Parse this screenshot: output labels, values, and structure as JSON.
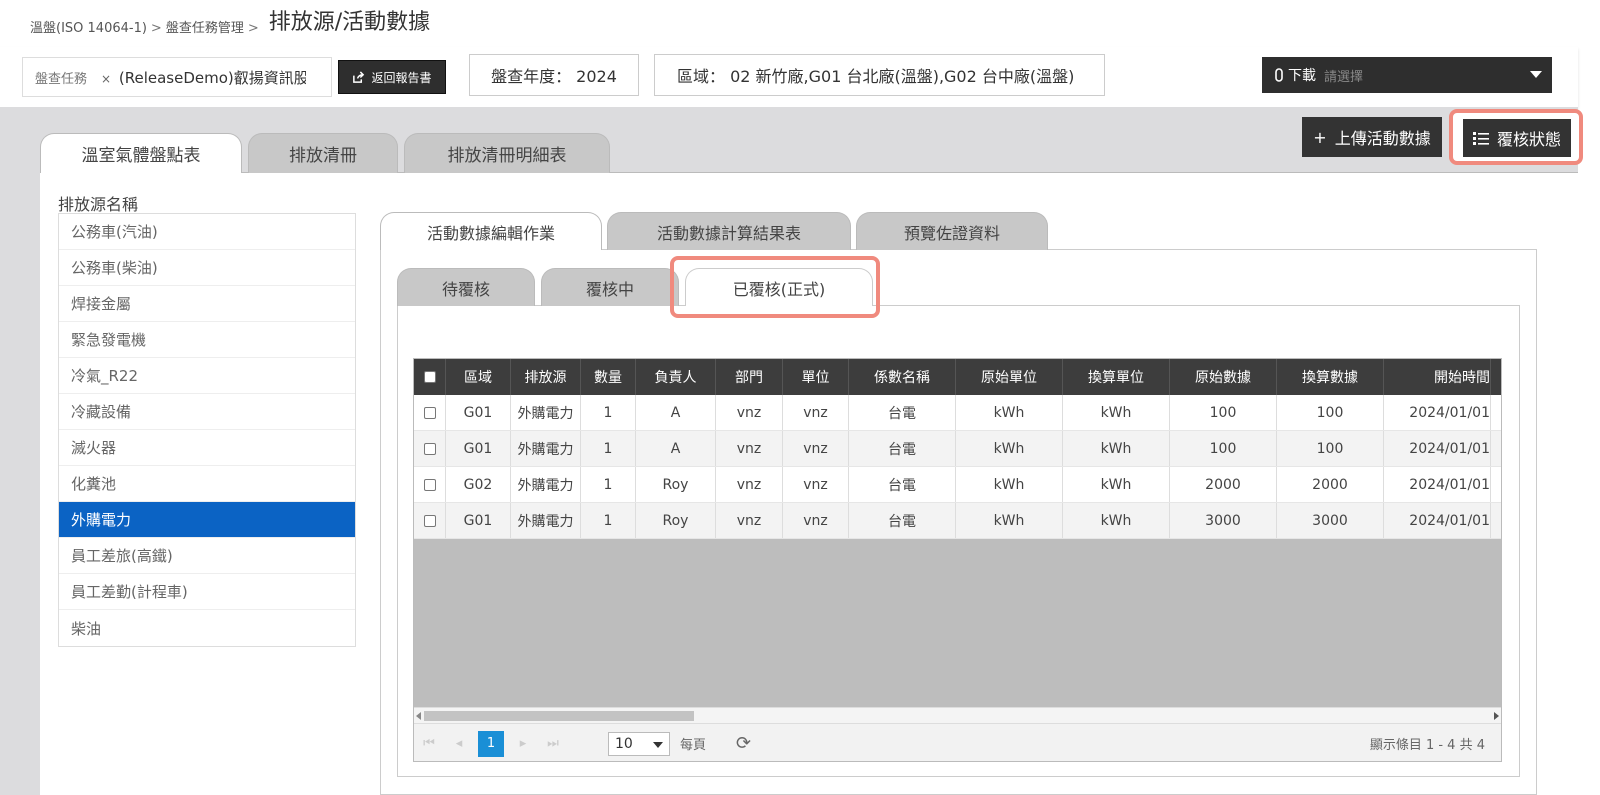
{
  "breadcrumb": {
    "items": [
      "溫盤(ISO 14064-1)",
      "盤查任務管理"
    ],
    "separator": ">",
    "title": "排放源/活動數據"
  },
  "toolbar": {
    "task_label": "盤查任務",
    "task_clear": "×",
    "task_value": "(ReleaseDemo)叡揚資訊股份有限公司",
    "return_label": "返回報告書",
    "year_text": "盤查年度： 2024",
    "region_text": "區域： 02 新竹廠,G01 台北廠(溫盤),G02 台中廠(溫盤)",
    "download_label": "下載",
    "download_placeholder": "請選擇",
    "upload_label": "上傳活動數據",
    "status_label": "覆核狀態"
  },
  "main_tabs": [
    {
      "label": "溫室氣體盤點表",
      "active": true
    },
    {
      "label": "排放清冊",
      "active": false
    },
    {
      "label": "排放清冊明細表",
      "active": false
    }
  ],
  "sources": {
    "title": "排放源名稱",
    "items": [
      "公務車(汽油)",
      "公務車(柴油)",
      "焊接金屬",
      "緊急發電機",
      "冷氣_R22",
      "冷藏設備",
      "滅火器",
      "化糞池",
      "外購電力",
      "員工差旅(高鐵)",
      "員工差勤(計程車)",
      "柴油"
    ],
    "selected": "外購電力"
  },
  "sub_tabs": [
    {
      "label": "活動數據編輯作業",
      "active": true
    },
    {
      "label": "活動數據計算結果表",
      "active": false
    },
    {
      "label": "預覽佐證資料",
      "active": false
    }
  ],
  "review_tabs": [
    {
      "label": "待覆核",
      "active": false
    },
    {
      "label": "覆核中",
      "active": false
    },
    {
      "label": "已覆核(正式)",
      "active": true
    }
  ],
  "grid": {
    "columns": [
      "區域",
      "排放源",
      "數量",
      "負責人",
      "部門",
      "單位",
      "係數名稱",
      "原始單位",
      "換算單位",
      "原始數據",
      "換算數據",
      "開始時間"
    ],
    "rows": [
      [
        "G01",
        "外購電力",
        "1",
        "A",
        "vnz",
        "vnz",
        "台電",
        "kWh",
        "kWh",
        "100",
        "100",
        "2024/01/01"
      ],
      [
        "G01",
        "外購電力",
        "1",
        "A",
        "vnz",
        "vnz",
        "台電",
        "kWh",
        "kWh",
        "100",
        "100",
        "2024/01/01"
      ],
      [
        "G02",
        "外購電力",
        "1",
        "Roy",
        "vnz",
        "vnz",
        "台電",
        "kWh",
        "kWh",
        "2000",
        "2000",
        "2024/01/01"
      ],
      [
        "G01",
        "外購電力",
        "1",
        "Roy",
        "vnz",
        "vnz",
        "台電",
        "kWh",
        "kWh",
        "3000",
        "3000",
        "2024/01/01"
      ]
    ]
  },
  "pager": {
    "current_page": "1",
    "page_size": "10",
    "per_page_label": "每頁",
    "info": "顯示條目 1 - 4 共 4"
  },
  "colors": {
    "accent_blue": "#0b63c4",
    "highlight": "#f08a7e",
    "dark_button": "#333333",
    "grid_header": "#3d3d3d"
  }
}
